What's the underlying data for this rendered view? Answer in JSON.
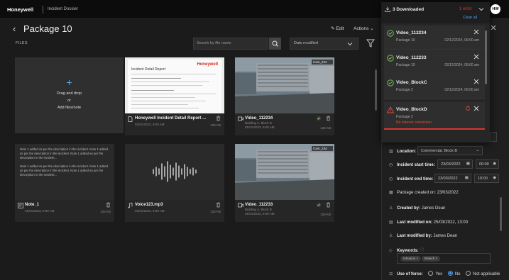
{
  "header": {
    "brand": "Honeywell",
    "app_title": "Incident Dossier",
    "user_initials": "HW"
  },
  "page": {
    "title": "Package 10",
    "edit_label": "Edit",
    "actions_label": "Actions",
    "files_label": "FILES",
    "search_placeholder": "Search by file name",
    "sort_value": "Date modified"
  },
  "upload": {
    "line1": "Drag and drop",
    "line2": "or",
    "line3": "Add files/note"
  },
  "files": [
    {
      "name": "Honeywell Incident Detail Report ...",
      "date": "01/01/2023, 9:00 AM",
      "size": "125 KB",
      "doc_brand": "Honeywell",
      "doc_title": "Incident Detail Report"
    },
    {
      "name": "Video_112234",
      "location": "Building A, Block B",
      "date": "01/01/2023, 9:00 AM",
      "size": "125 KB",
      "cam": "Cam_234"
    },
    {
      "name": "Note_1",
      "date": "01/01/2023, 9:00 AM",
      "size": "125 KB",
      "note_p1": "Note 1 added as per the description in the incident. Note 1 added as per the description in the incident. Note 1 added as per the description in the incident...",
      "note_p2": "Note 1 added as per the description in the incident. Note 1 added as per the description in the incident. Note 1 added as per the description in the incident..."
    },
    {
      "name": "Voice123.mp3",
      "date": "01/01/2023, 9:00 AM",
      "size": "125 KB"
    },
    {
      "name": "Video_112233",
      "location": "Building A, Block B",
      "date": "01/01/2023, 9:00 AM",
      "size": "125 KB",
      "cam": "Cam_234"
    }
  ],
  "downloads": {
    "title": "3 Downloaded",
    "status": "1 error",
    "clear_all": "Clear all",
    "items": [
      {
        "name": "Video_112234",
        "package": "Package 10",
        "date": "02/12/2024, 09:00 am"
      },
      {
        "name": "Video_112233",
        "package": "Package 10",
        "date": "02/12/2024, 09:00 am"
      },
      {
        "name": "Video_BlockC",
        "package": "Package 2",
        "date": "02/12/2024, 09:00 am"
      },
      {
        "name": "Video_BlockD",
        "package": "Package 2",
        "error": "No internet connection"
      }
    ]
  },
  "details": {
    "location_label": "Location:",
    "location_value": "Commercial, Block B",
    "start_label": "Incident start time:",
    "start_date": "23/03/2022",
    "start_time": "00:00",
    "end_label": "Incident end time:",
    "end_date": "23/03/2022",
    "end_time": "10:00",
    "created_on": "Package created on: 23/03/2022",
    "created_by_label": "Created by:",
    "created_by": "James Dean",
    "last_modified_on_label": "Last modified on:",
    "last_modified_on": "25/03/2022, 13:00",
    "last_modified_by_label": "Last modified by:",
    "last_modified_by": "James Dean",
    "keywords_label": "Keywords:",
    "keywords": [
      "Intrusion",
      "Breach"
    ],
    "use_of_force_label": "Use of force:",
    "use_of_force_options": [
      "Yes",
      "No",
      "Not applicable"
    ]
  }
}
